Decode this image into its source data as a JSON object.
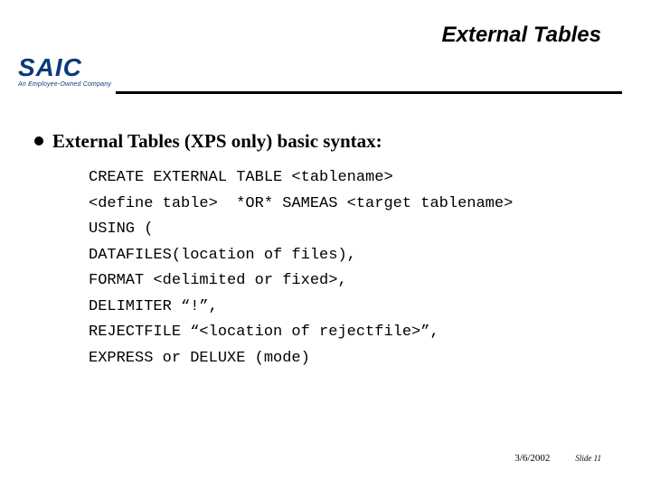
{
  "header": {
    "title": "External Tables"
  },
  "logo": {
    "name": "SAIC",
    "tagline": "An Employee-Owned Company"
  },
  "main": {
    "bullet": "External Tables (XPS only) basic syntax:",
    "code_lines": [
      "CREATE EXTERNAL TABLE <tablename>",
      "<define table>  *OR* SAMEAS <target tablename>",
      "USING (",
      "DATAFILES(location of files),",
      "FORMAT <delimited or fixed>,",
      "DELIMITER “!”,",
      "REJECTFILE “<location of rejectfile>”,",
      "EXPRESS or DELUXE (mode)"
    ]
  },
  "footer": {
    "date": "3/6/2002",
    "slide": "Slide 11"
  }
}
